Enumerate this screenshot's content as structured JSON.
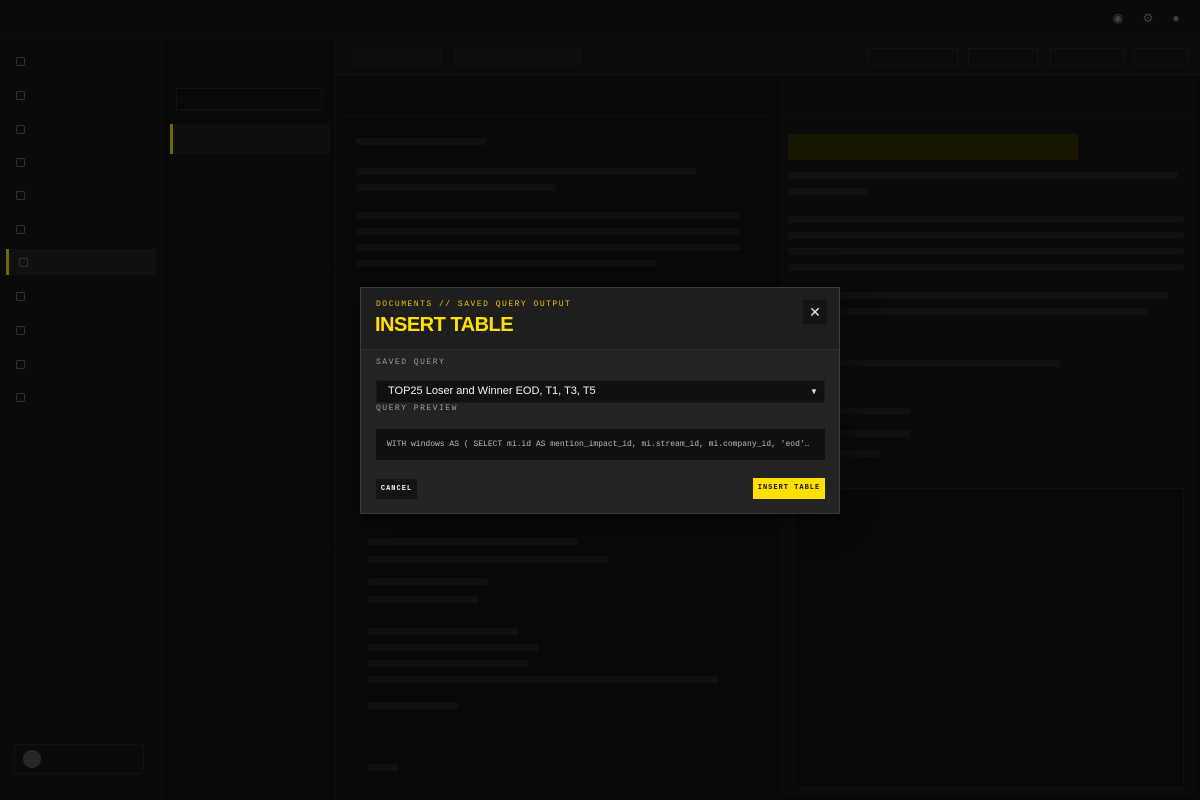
{
  "modal": {
    "kicker": "DOCUMENTS // SAVED QUERY OUTPUT",
    "title": "INSERT TABLE",
    "close_icon": "close-icon",
    "saved_query_label": "SAVED QUERY",
    "saved_query_value": "TOP25 Loser and Winner EOD, T1, T3, T5",
    "query_preview_label": "QUERY PREVIEW",
    "query_preview_text": "WITH windows AS ( SELECT mi.id AS mention_impact_id, mi.stream_id, mi.company_id, 'eod' AS window_label",
    "cancel_label": "CANCEL",
    "insert_label": "INSERT TABLE"
  },
  "colors": {
    "accent": "#ffe000",
    "modal_bg": "#1e1e1e",
    "input_bg": "#111111"
  }
}
